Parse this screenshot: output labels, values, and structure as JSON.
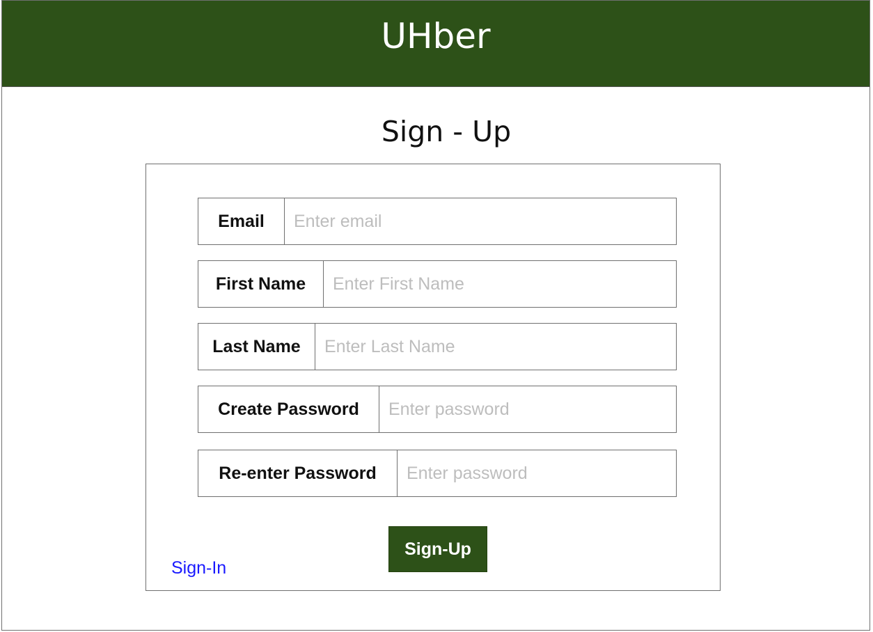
{
  "header": {
    "title": "UHber"
  },
  "page": {
    "title": "Sign - Up"
  },
  "form": {
    "fields": [
      {
        "label": "Email",
        "placeholder": "Enter email",
        "value": ""
      },
      {
        "label": "First Name",
        "placeholder": "Enter First Name",
        "value": ""
      },
      {
        "label": "Last Name",
        "placeholder": "Enter Last Name",
        "value": ""
      },
      {
        "label": "Create Password",
        "placeholder": "Enter password",
        "value": ""
      },
      {
        "label": "Re-enter Password",
        "placeholder": "Enter password",
        "value": ""
      }
    ],
    "submit_label": "Sign-Up",
    "signin_link": "Sign-In"
  },
  "colors": {
    "header_bg": "#2d5118",
    "button_bg": "#2d5118",
    "link": "#1a1aff",
    "placeholder": "#bdbdbd"
  }
}
